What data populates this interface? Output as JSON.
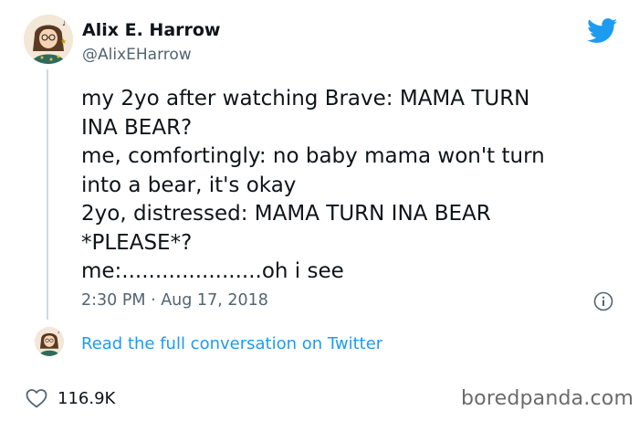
{
  "author": {
    "display_name": "Alix E. Harrow",
    "handle": "@AlixEHarrow"
  },
  "tweet": {
    "lines": [
      "my 2yo after watching Brave: MAMA TURN",
      "INA BEAR?",
      "me, comfortingly: no baby mama won't turn",
      "into a bear, it's okay",
      "2yo, distressed: MAMA TURN INA BEAR",
      "*PLEASE*?",
      "me:.....................oh i see"
    ],
    "timestamp": "2:30 PM · Aug 17, 2018"
  },
  "conversation": {
    "link_label": "Read the full conversation on Twitter"
  },
  "engagement": {
    "likes": "116.9K"
  },
  "watermark": "boredpanda.com",
  "colors": {
    "twitter_blue": "#1d9bf0",
    "text": "#0f1419",
    "secondary": "#536471"
  },
  "icons": [
    "twitter-bird-icon",
    "info-icon",
    "heart-icon"
  ]
}
